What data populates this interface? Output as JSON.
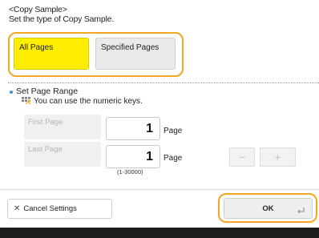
{
  "header": {
    "title": "<Copy Sample>",
    "subtitle": "Set the type of Copy Sample."
  },
  "type_selector": {
    "all_pages": "All Pages",
    "specified_pages": "Specified Pages"
  },
  "page_range": {
    "title": "Set Page Range",
    "hint": "You can use the numeric keys.",
    "first_label": "First Page",
    "first_value": "1",
    "last_label": "Last Page",
    "last_value": "1",
    "unit": "Page",
    "range_note": "(1-30000)",
    "minus": "−",
    "plus": "+"
  },
  "footer_actions": {
    "cancel": "Cancel Settings",
    "ok": "OK"
  },
  "colors": {
    "accent": "#f5a623",
    "selected": "#ffee00",
    "footer": "#1d1d1d"
  }
}
